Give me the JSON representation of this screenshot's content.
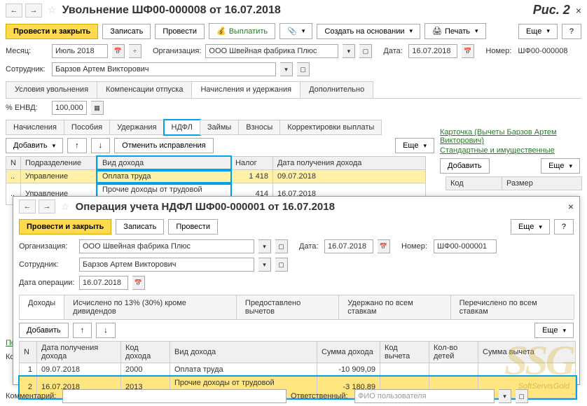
{
  "figLabel": "Рис. 2",
  "win1": {
    "title": "Увольнение ШФ00-000008 от 16.07.2018",
    "buttons": {
      "postClose": "Провести и закрыть",
      "save": "Записать",
      "post": "Провести",
      "pay": "Выплатить",
      "createFrom": "Создать на основании",
      "print": "Печать",
      "more": "Еще"
    },
    "fields": {
      "monthLbl": "Месяц:",
      "month": "Июль 2018",
      "orgLbl": "Организация:",
      "org": "ООО Швейная фабрика Плюс",
      "dateLbl": "Дата:",
      "date": "16.07.2018",
      "numLbl": "Номер:",
      "num": "ШФ00-000008",
      "empLbl": "Сотрудник:",
      "emp": "Барзов Артем Викторович",
      "envdLbl": "% ЕНВД:",
      "envd": "100,000"
    },
    "tabs": [
      "Условия увольнения",
      "Компенсации отпуска",
      "Начисления и удержания",
      "Дополнительно"
    ],
    "activeTab": 2,
    "subtabs": [
      "Начисления",
      "Пособия",
      "Удержания",
      "НДФЛ",
      "Займы",
      "Взносы",
      "Корректировки выплаты"
    ],
    "activeSubtab": 3,
    "innerBtns": {
      "add": "Добавить",
      "cancelFix": "Отменить исправления",
      "more": "Еще"
    },
    "sideLinks": {
      "card": "Карточка (Вычеты Барзов Артем Викторович)",
      "std": "Стандартные и имущественные"
    },
    "tableCols": [
      "N",
      "Подразделение",
      "Вид дохода",
      "Налог",
      "Дата получения дохода"
    ],
    "rows": [
      {
        "n": "..",
        "dept": "Управление",
        "type": "Оплата труда",
        "tax": "1 418",
        "date": "09.07.2018",
        "yellow": true
      },
      {
        "n": "..",
        "dept": "Управление",
        "type": "Прочие доходы от трудовой деятел...",
        "tax": "414",
        "date": "16.07.2018"
      }
    ],
    "sideTable": {
      "add": "Добавить",
      "more": "Еще",
      "cols": [
        "Код",
        "Размер"
      ]
    }
  },
  "win2": {
    "title": "Операция учета НДФЛ ШФ00-000001 от 16.07.2018",
    "buttons": {
      "postClose": "Провести и закрыть",
      "save": "Записать",
      "post": "Провести",
      "more": "Еще"
    },
    "fields": {
      "orgLbl": "Организация:",
      "org": "ООО Швейная фабрика Плюс",
      "dateLbl": "Дата:",
      "date": "16.07.2018",
      "numLbl": "Номер:",
      "num": "ШФ00-000001",
      "empLbl": "Сотрудник:",
      "emp": "Барзов Артем Викторович",
      "opDateLbl": "Дата операции:",
      "opDate": "16.07.2018"
    },
    "tabs": [
      "Доходы",
      "Исчислено по 13% (30%) кроме дивидендов",
      "Предоставлено вычетов",
      "Удержано по всем ставкам",
      "Перечислено по всем ставкам"
    ],
    "activeTab": 0,
    "innerBtns": {
      "add": "Добавить",
      "more": "Еще"
    },
    "tableCols": [
      "N",
      "Дата получения дохода",
      "Код дохода",
      "Вид дохода",
      "Сумма дохода",
      "Код вычета",
      "Кол-во детей",
      "Сумма вычета"
    ],
    "rows": [
      {
        "n": "1",
        "date": "09.07.2018",
        "code": "2000",
        "type": "Оплата труда",
        "sum": "-10 909,09",
        "vcode": "",
        "kids": "",
        "vsum": ""
      },
      {
        "n": "2",
        "date": "16.07.2018",
        "code": "2013",
        "type": "Прочие доходы от трудовой деятельности",
        "sum": "-3 180,89",
        "vcode": "",
        "kids": "",
        "vsum": "",
        "sel": true
      }
    ],
    "bottom": {
      "commentLbl": "Комментарий:",
      "respLbl": "Ответственный:",
      "respPh": "ФИО пользователя"
    }
  },
  "outerBottom": {
    "poLbl": "По",
    "komLbl": "Ком"
  }
}
